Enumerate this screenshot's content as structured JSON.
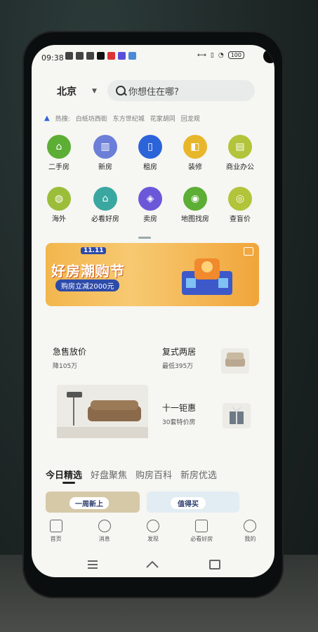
{
  "status": {
    "time": "09:38",
    "battery": "100"
  },
  "header": {
    "city": "北京",
    "search_placeholder": "你想住在哪?"
  },
  "hot": {
    "label": "热搜:",
    "tags": [
      "白纸坊西街",
      "东方世纪城",
      "花家胡同",
      "回龙观"
    ]
  },
  "grid": [
    {
      "label": "二手房",
      "color": "#5cae35",
      "icon": "house-icon"
    },
    {
      "label": "新房",
      "color": "#6b7fd8",
      "icon": "building-icon"
    },
    {
      "label": "租房",
      "color": "#2b63d9",
      "icon": "door-icon"
    },
    {
      "label": "装修",
      "color": "#e8b62a",
      "icon": "paint-icon"
    },
    {
      "label": "商业办公",
      "color": "#b2c43a",
      "icon": "office-icon"
    },
    {
      "label": "海外",
      "color": "#9bbd3a",
      "icon": "globe-icon"
    },
    {
      "label": "必看好房",
      "color": "#3aa8a0",
      "icon": "home-check-icon"
    },
    {
      "label": "卖房",
      "color": "#6b58d8",
      "icon": "sell-icon"
    },
    {
      "label": "地图找房",
      "color": "#5cae35",
      "icon": "map-pin-icon"
    },
    {
      "label": "查盲价",
      "color": "#b2c43a",
      "icon": "price-icon"
    }
  ],
  "banner": {
    "logo": "11.11",
    "title": "好房潮购节",
    "subtitle": "购房立减2000元"
  },
  "promos": [
    {
      "title": "急售放价",
      "sub": "降105万"
    },
    {
      "title": "复式两居",
      "sub": "最低395万"
    },
    {
      "title": "十一钜惠",
      "sub": "30套特价房"
    }
  ],
  "tabs": [
    "今日精选",
    "好盘聚焦",
    "购房百科",
    "新房优选"
  ],
  "cards": [
    "一周新上",
    "值得买"
  ],
  "nav": [
    "首页",
    "消息",
    "发现",
    "必看好房",
    "我的"
  ]
}
